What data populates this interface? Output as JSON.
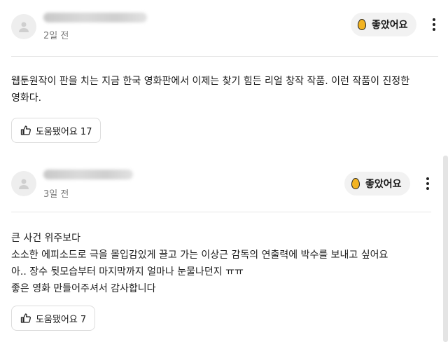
{
  "reviews": [
    {
      "time": "2일 전",
      "like_label": "좋았어요",
      "content": "웹툰원작이 판을 치는 지금 한국 영화판에서 이제는 찾기 힘든 리얼 창작 작품. 이런 작품이 진정한\n영화다.",
      "helpful_label": "도움됐어요 17"
    },
    {
      "time": "3일 전",
      "like_label": "좋았어요",
      "content": "큰 사건 위주보다\n소소한 에피소드로 극을 몰입감있게 끌고 가는 이상근 감독의 연출력에 박수를 보내고 싶어요\n아.. 장수 뒷모습부터 마지막까지 얼마나 눈물나던지 ㅠㅠ\n좋은 영화 만들어주셔서 감사합니다",
      "helpful_label": "도움됐어요 7"
    }
  ],
  "colors": {
    "egg": "#f2b321",
    "button_bg": "#f2f2f2"
  },
  "icons": [
    "user-icon",
    "egg-icon",
    "more-vertical-icon",
    "thumbs-up-icon"
  ]
}
